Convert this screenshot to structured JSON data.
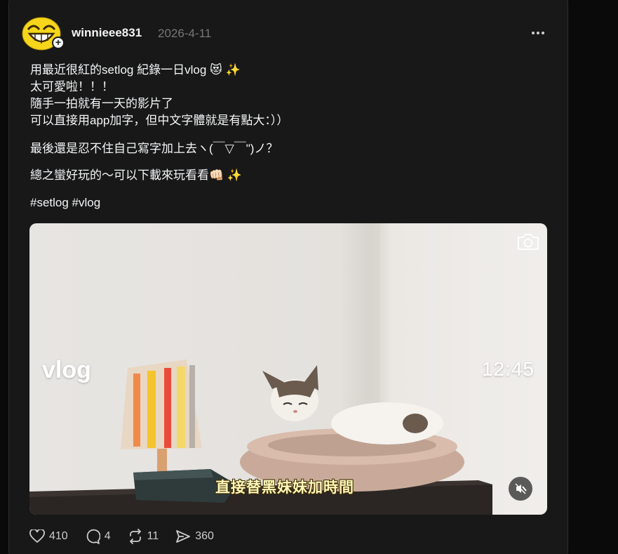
{
  "post": {
    "username": "winnieee831",
    "date": "2026-4-11",
    "lines": [
      "用最近很紅的setlog 紀錄一日vlog 😻 ✨",
      "太可愛啦！！！",
      "隨手一拍就有一天的影片了",
      "可以直接用app加字，但中文字體就是有點大：））",
      "最後還是忍不住自己寫字加上去ヽ(￣▽￣\")ノ？",
      "總之蠻好玩的～可以下載來玩看看👊🏻 ✨",
      "#setlog #vlog"
    ]
  },
  "video": {
    "title_overlay": "vlog",
    "time_overlay": "12:45",
    "handwritten_caption": "直接替黑妹妹加時間"
  },
  "actions": {
    "likes": "410",
    "comments": "4",
    "reposts": "11",
    "shares": "360"
  },
  "icons": {
    "avatar": "smiley-avatar",
    "follow": "plus-icon",
    "more": "more-icon",
    "camera": "camera-icon",
    "mute": "mute-icon",
    "like": "heart-icon",
    "comment": "comment-icon",
    "repost": "repost-icon",
    "share": "share-icon"
  }
}
